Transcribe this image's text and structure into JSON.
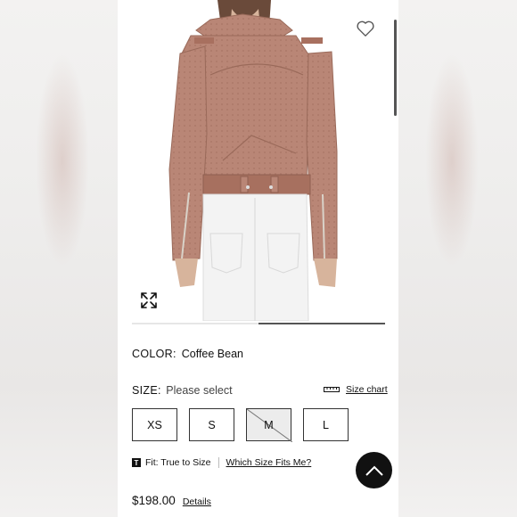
{
  "product": {
    "color_label": "COLOR:",
    "color_value": "Coffee Bean",
    "size_label": "SIZE:",
    "size_placeholder": "Please select",
    "size_chart_label": "Size chart",
    "sizes": [
      {
        "label": "XS",
        "available": true
      },
      {
        "label": "S",
        "available": true
      },
      {
        "label": "M",
        "available": false
      },
      {
        "label": "L",
        "available": true
      }
    ],
    "fit_badge": "T",
    "fit_text": "Fit: True to Size",
    "fit_link": "Which Size Fits Me?",
    "price": "$198.00",
    "details_link": "Details"
  },
  "gallery": {
    "progress": 0.5
  },
  "icons": {
    "favorite": "heart-icon",
    "expand": "expand-icon",
    "size_chart": "ruler-icon",
    "scroll_top": "chevron-up-icon"
  },
  "colors": {
    "jacket": "#b98676",
    "jeans": "#f3f3f3",
    "accent": "#111111"
  }
}
